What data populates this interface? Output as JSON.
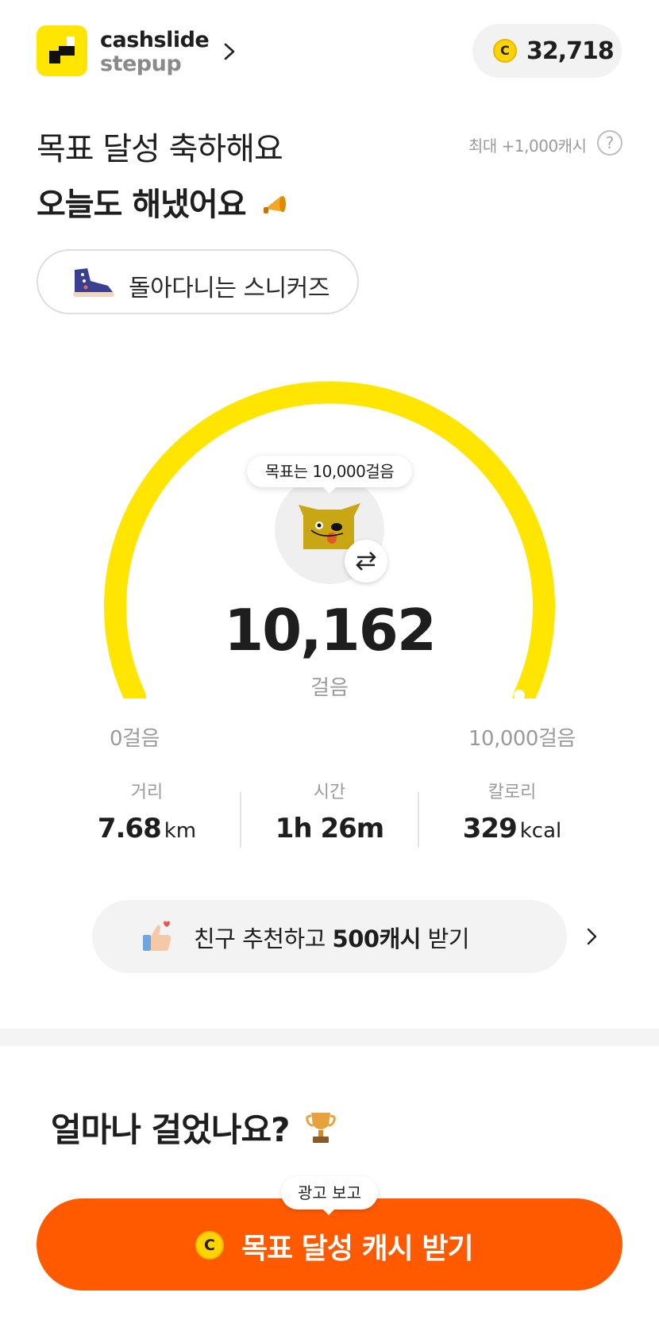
{
  "header": {
    "logo_title": "cashslide",
    "logo_subtitle": "stepup",
    "cash_balance": "32,718",
    "coin_symbol": "C"
  },
  "headline": {
    "line1": "목표 달성 축하해요",
    "line2": "오늘도 해냈어요",
    "max_cash": "최대 +1,000캐시",
    "help_symbol": "?"
  },
  "character_pill": {
    "label": "돌아다니는 스니커즈"
  },
  "gauge": {
    "goal_bubble": "목표는 10,000걸음",
    "steps": "10,162",
    "steps_unit": "걸음",
    "min_label": "0걸음",
    "max_label": "10,000걸음",
    "progress": 1.0,
    "color": "#FFE500"
  },
  "stats": [
    {
      "label": "거리",
      "value": "7.68",
      "unit": "km"
    },
    {
      "label": "시간",
      "value": "1h 26m",
      "unit": ""
    },
    {
      "label": "칼로리",
      "value": "329",
      "unit": "kcal"
    }
  ],
  "referral": {
    "prefix": "친구 추천하고 ",
    "highlight": "500캐시",
    "suffix": " 받기"
  },
  "walk_section": {
    "title": "얼마나 걸었나요?"
  },
  "cta": {
    "ad_tag": "광고 보고",
    "label": "목표 달성 캐시 받기",
    "color": "#FF5A00"
  },
  "icons": [
    "logo-icon",
    "chevron-right-icon",
    "coin-icon",
    "megaphone-icon",
    "help-icon",
    "sneaker-icon",
    "dog-character-icon",
    "swap-icon",
    "thumbs-up-icon",
    "trophy-icon"
  ]
}
